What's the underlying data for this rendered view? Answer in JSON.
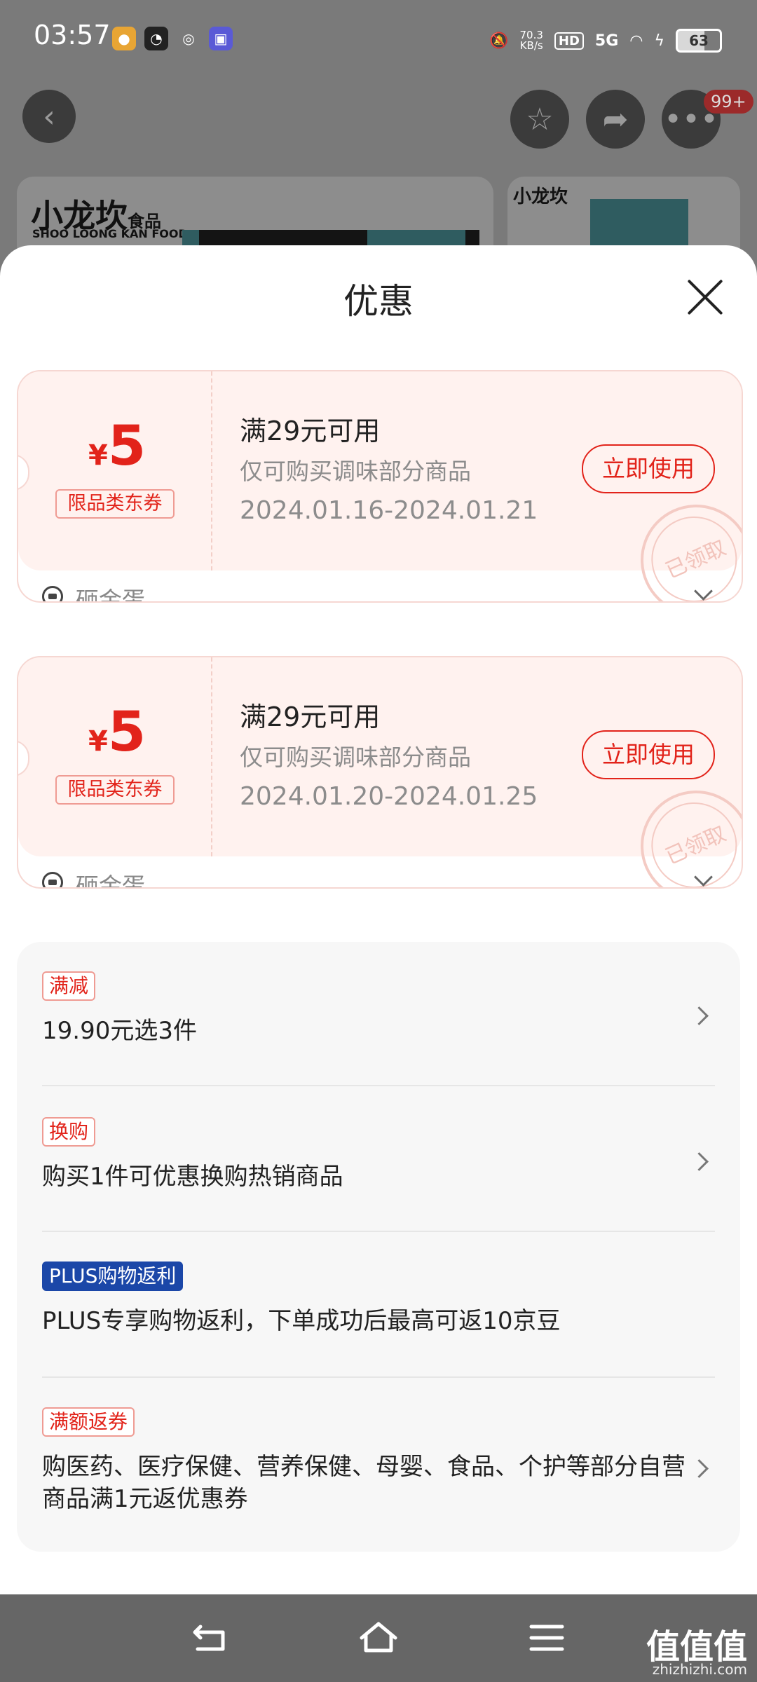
{
  "status_bar": {
    "time": "03:57",
    "net_speed_value": "70.3",
    "net_speed_unit": "KB/s",
    "hd": "HD",
    "network": "5G",
    "battery": "63",
    "notif_icons": [
      "lion-app-icon",
      "qq-icon",
      "wechat-icon",
      "sticker-app-icon"
    ]
  },
  "top_bar": {
    "more_badge": "99+"
  },
  "background_products": {
    "brand": "小龙坎",
    "brand_suffix": "食品",
    "brand_en": "SHOO LOONG KAN FOOD"
  },
  "sheet": {
    "title": "优惠",
    "coupons": [
      {
        "currency": "¥",
        "amount": "5",
        "type_tag": "限品类东券",
        "condition": "满29元可用",
        "scope": "仅可购买调味部分商品",
        "date_range": "2024.01.16-2024.01.21",
        "button": "立即使用",
        "stamp": "已领取",
        "source": "砸金蛋"
      },
      {
        "currency": "¥",
        "amount": "5",
        "type_tag": "限品类东券",
        "condition": "满29元可用",
        "scope": "仅可购买调味部分商品",
        "date_range": "2024.01.20-2024.01.25",
        "button": "立即使用",
        "stamp": "已领取",
        "source": "砸金蛋"
      }
    ],
    "promotions": [
      {
        "tag": "满减",
        "text": "19.90元选3件"
      },
      {
        "tag": "换购",
        "text": "购买1件可优惠换购热销商品"
      },
      {
        "tag": "PLUS购物返利",
        "text": "PLUS专享购物返利，下单成功后最高可返10京豆"
      },
      {
        "tag": "满额返券",
        "text": "购医药、医疗保健、营养保健、母婴、食品、个护等部分自营商品满1元返优惠券"
      }
    ]
  },
  "watermark": {
    "text": "值值值",
    "sub": "zhizhizhi.com"
  },
  "colors": {
    "accent_red": "#e2231a",
    "coupon_bg": "#fff2ef",
    "plus_blue": "#1b47a8"
  }
}
